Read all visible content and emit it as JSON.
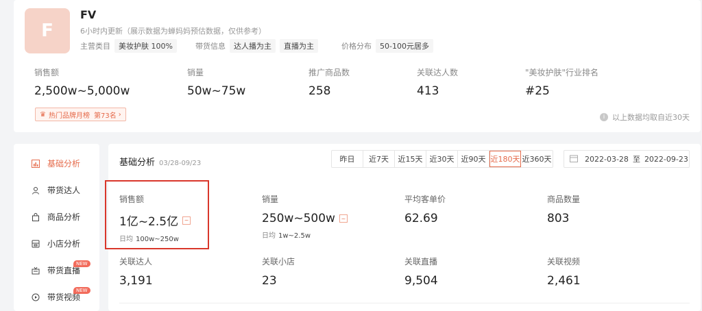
{
  "brand": {
    "logo_letter": "F",
    "name": "FV",
    "update_note": "6小时内更新（展示数据为蝉妈妈预估数据，仅供参考）",
    "category_label": "主营类目",
    "category_value": "美妆护肤 100%",
    "sales_info_label": "带货信息",
    "sales_info_tags": [
      "达人播为主",
      "直播为主"
    ],
    "price_label": "价格分布",
    "price_value": "50-100元居多"
  },
  "summary": [
    {
      "label": "销售额",
      "value": "2,500w~5,000w"
    },
    {
      "label": "销量",
      "value": "50w~75w"
    },
    {
      "label": "推广商品数",
      "value": "258"
    },
    {
      "label": "关联达人数",
      "value": "413"
    },
    {
      "label": "\"美妆护肤\"行业排名",
      "value": "#25"
    }
  ],
  "rank_badge": {
    "icon": "crown-icon",
    "title": "热门品牌月榜",
    "rank": "第73名",
    "arrow": "›"
  },
  "data_note": "以上数据均取自近30天",
  "sidebar": {
    "items": [
      {
        "label": "基础分析",
        "icon": "chart-icon",
        "active": true
      },
      {
        "label": "带货达人",
        "icon": "person-icon"
      },
      {
        "label": "商品分析",
        "icon": "bag-icon"
      },
      {
        "label": "小店分析",
        "icon": "store-icon"
      },
      {
        "label": "带货直播",
        "icon": "live-icon",
        "badge": "NEW"
      },
      {
        "label": "带货视频",
        "icon": "video-icon",
        "badge": "NEW"
      }
    ]
  },
  "analysis": {
    "title": "基础分析",
    "date_range_short": "03/28-09/23",
    "periods": [
      "昨日",
      "近7天",
      "近15天",
      "近30天",
      "近90天",
      "近180天",
      "近360天"
    ],
    "active_period": "近180天",
    "start_date": "2022-03-28",
    "date_separator": "至",
    "end_date": "2022-09-23",
    "daily_label": "日均",
    "metrics": [
      {
        "label": "销售额",
        "value": "1亿~2.5亿",
        "daily": "100w~250w",
        "trend": true
      },
      {
        "label": "销量",
        "value": "250w~500w",
        "daily": "1w~2.5w",
        "trend": true
      },
      {
        "label": "平均客单价",
        "value": "62.69"
      },
      {
        "label": "商品数量",
        "value": "803"
      },
      {
        "label": "关联达人",
        "value": "3,191"
      },
      {
        "label": "关联小店",
        "value": "23"
      },
      {
        "label": "关联直播",
        "value": "9,504"
      },
      {
        "label": "关联视频",
        "value": "2,461"
      }
    ]
  },
  "colors": {
    "accent": "#e56a4a",
    "highlight_border": "#d9362a",
    "logo_bg": "#f6d3c8"
  }
}
